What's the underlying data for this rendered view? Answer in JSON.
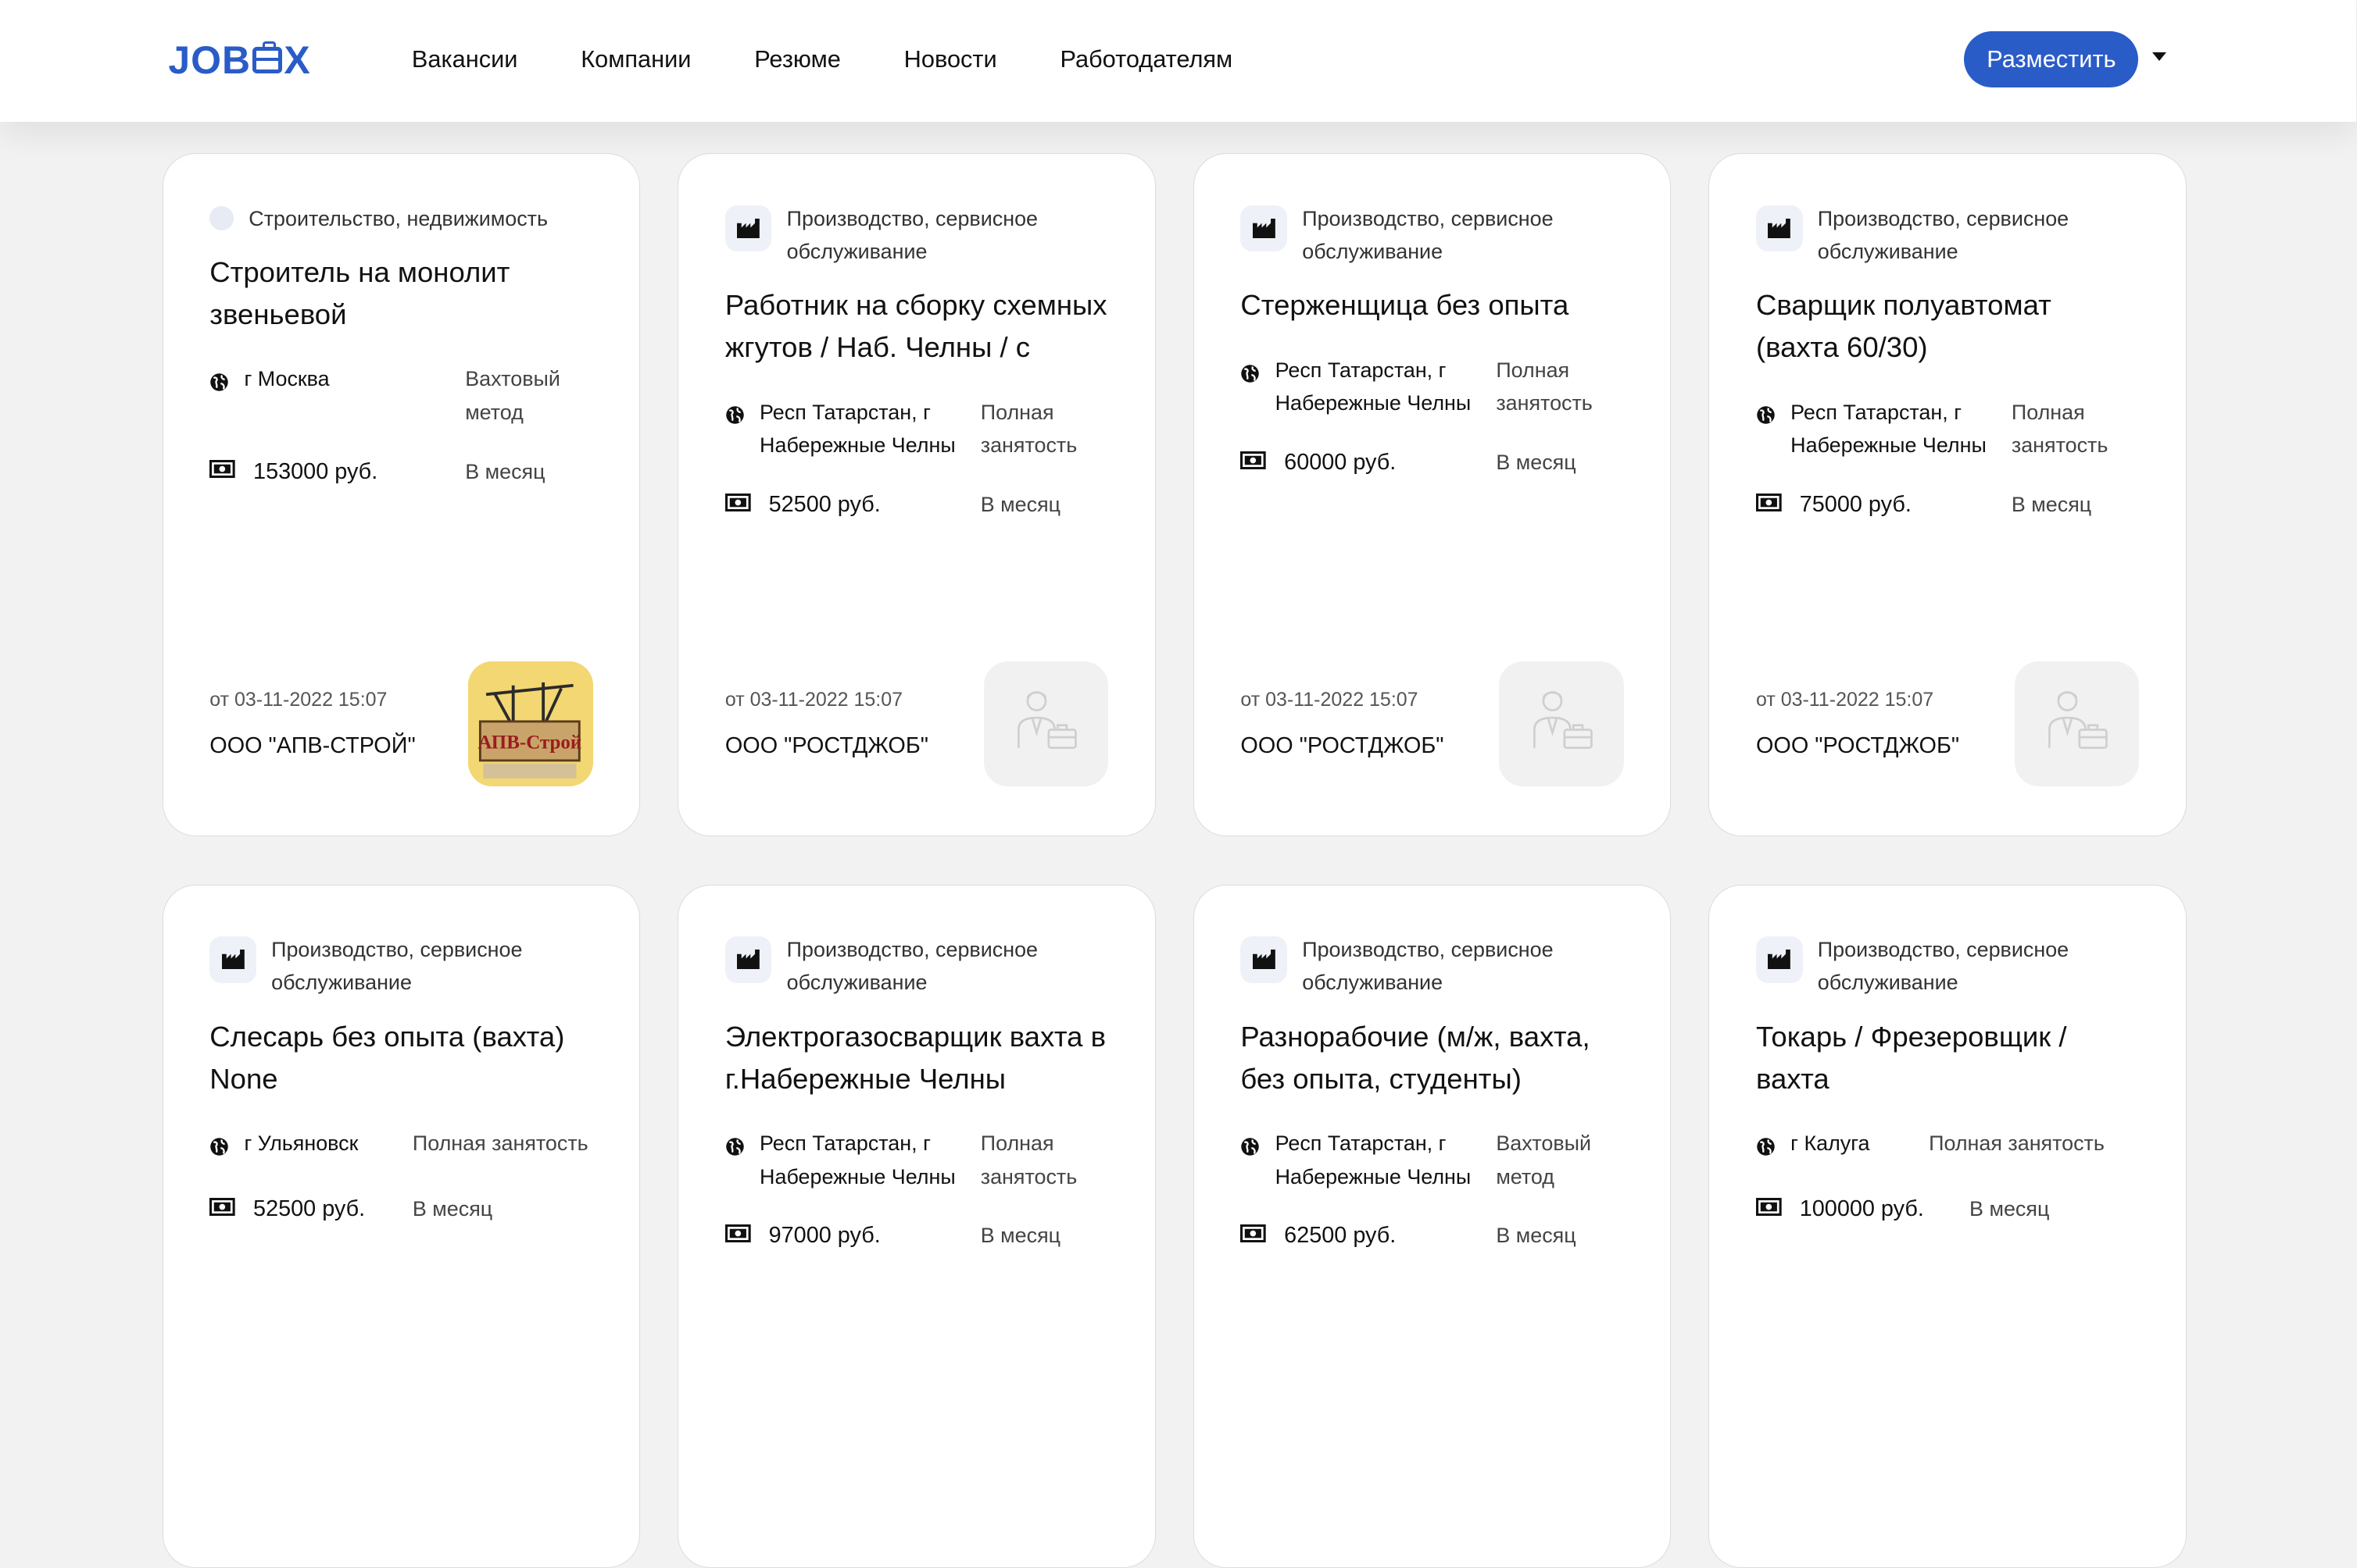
{
  "header": {
    "logo": "JOBOX",
    "nav": [
      "Вакансии",
      "Компании",
      "Резюме",
      "Новости",
      "Работодателям"
    ],
    "post_button": "Разместить"
  },
  "icons": {
    "category_default": "building-icon",
    "category_first": "dot-icon",
    "location": "globe-icon",
    "salary": "money-icon",
    "company_placeholder": "businessman-briefcase-icon"
  },
  "colors": {
    "accent": "#2a5cc8"
  },
  "cards": [
    {
      "category": "Строительство, недвижимость",
      "title": "Строитель на монолит звеньевой",
      "location": "г Москва",
      "employment": "Вахтовый метод",
      "salary": "153000 руб.",
      "period": "В месяц",
      "date": "от 03-11-2022 15:07",
      "company": "ООО \"АПВ-СТРОЙ\"",
      "logo_text": "АПВ-Строй"
    },
    {
      "category": "Производство, сервисное обслуживание",
      "title": "Работник на сборку схемных жгутов / Наб. Челны / с",
      "location": "Респ Татарстан, г Набережные Челны",
      "employment": "Полная занятость",
      "salary": "52500 руб.",
      "period": "В месяц",
      "date": "от 03-11-2022 15:07",
      "company": "ООО \"РОСТДЖОБ\""
    },
    {
      "category": "Производство, сервисное обслуживание",
      "title": "Стерженщица без опыта",
      "location": "Респ Татарстан, г Набережные Челны",
      "employment": "Полная занятость",
      "salary": "60000 руб.",
      "period": "В месяц",
      "date": "от 03-11-2022 15:07",
      "company": "ООО \"РОСТДЖОБ\""
    },
    {
      "category": "Производство, сервисное обслуживание",
      "title": "Сварщик полуавтомат (вахта 60/30)",
      "location": "Респ Татарстан, г Набережные Челны",
      "employment": "Полная занятость",
      "salary": "75000 руб.",
      "period": "В месяц",
      "date": "от 03-11-2022 15:07",
      "company": "ООО \"РОСТДЖОБ\""
    },
    {
      "category": "Производство, сервисное обслуживание",
      "title": "Слесарь без опыта (вахта) None",
      "location": "г Ульяновск",
      "employment": "Полная занятость",
      "salary": "52500 руб.",
      "period": "В месяц"
    },
    {
      "category": "Производство, сервисное обслуживание",
      "title": "Электрогазосварщик вахта в г.Набережные Челны",
      "location": "Респ Татарстан, г Набережные Челны",
      "employment": "Полная занятость",
      "salary": "97000 руб.",
      "period": "В месяц"
    },
    {
      "category": "Производство, сервисное обслуживание",
      "title": "Разнорабочие (м/ж, вахта, без опыта, студенты)",
      "location": "Респ Татарстан, г Набережные Челны",
      "employment": "Вахтовый метод",
      "salary": "62500 руб.",
      "period": "В месяц"
    },
    {
      "category": "Производство, сервисное обслуживание",
      "title": "Токарь / Фрезеровщик / вахта",
      "location": "г Калуга",
      "employment": "Полная занятость",
      "salary": "100000 руб.",
      "period": "В месяц"
    }
  ]
}
